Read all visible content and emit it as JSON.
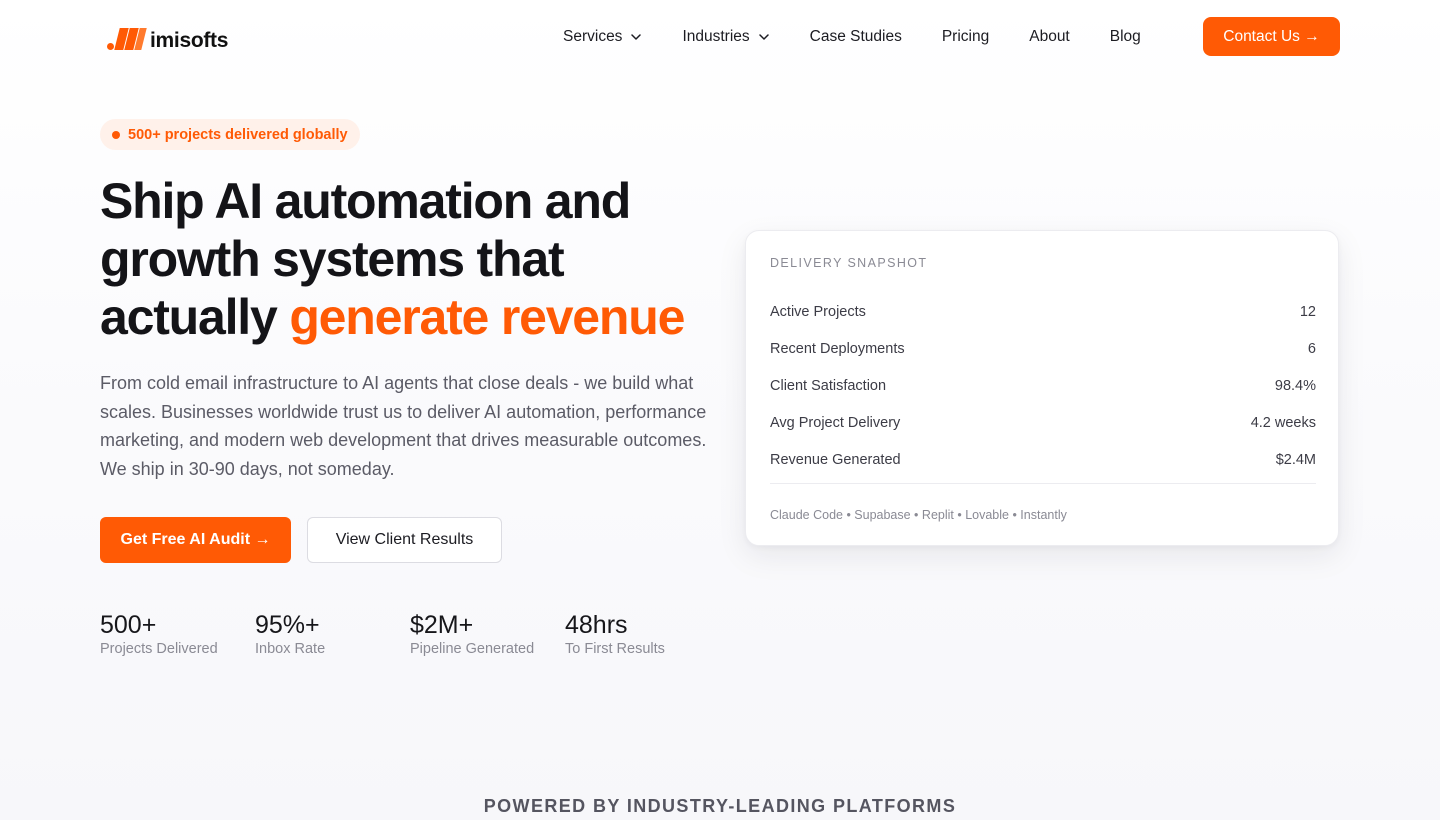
{
  "brand": {
    "name": "imisofts",
    "accent_color": "#ff5a05"
  },
  "nav": {
    "items": [
      {
        "label": "Services",
        "dropdown": true
      },
      {
        "label": "Industries",
        "dropdown": true
      },
      {
        "label": "Case Studies",
        "dropdown": false
      },
      {
        "label": "Pricing",
        "dropdown": false
      },
      {
        "label": "About",
        "dropdown": false
      },
      {
        "label": "Blog",
        "dropdown": false
      }
    ],
    "cta_label": "Contact Us →",
    "dropdown_icon": "chevron-down-icon"
  },
  "hero": {
    "badge": "500+ projects delivered globally",
    "headline_line1": "Ship AI automation and",
    "headline_line2": "growth systems that",
    "headline_line3_plain": "actually ",
    "headline_line3_accent": "generate revenue",
    "subcopy": "From cold email infrastructure to AI agents that close deals - we build what scales. Businesses worldwide trust us to deliver AI automation, performance marketing, and modern web development that drives measurable outcomes. We ship in 30-90 days, not someday.",
    "primary_cta": "Get Free AI Audit →",
    "secondary_cta": "View Client Results",
    "stats": [
      {
        "value": "500+",
        "label": "Projects Delivered"
      },
      {
        "value": "95%+",
        "label": "Inbox Rate"
      },
      {
        "value": "$2M+",
        "label": "Pipeline Generated"
      },
      {
        "value": "48hrs",
        "label": "To First Results"
      }
    ]
  },
  "snapshot": {
    "title": "DELIVERY SNAPSHOT",
    "rows": [
      {
        "label": "Active Projects",
        "value": "12"
      },
      {
        "label": "Recent Deployments",
        "value": "6"
      },
      {
        "label": "Client Satisfaction",
        "value": "98.4%"
      },
      {
        "label": "Avg Project Delivery",
        "value": "4.2 weeks"
      },
      {
        "label": "Revenue Generated",
        "value": "$2.4M"
      }
    ],
    "tools": "Claude Code • Supabase • Replit • Lovable • Instantly"
  },
  "powered_by": "POWERED BY INDUSTRY-LEADING PLATFORMS"
}
